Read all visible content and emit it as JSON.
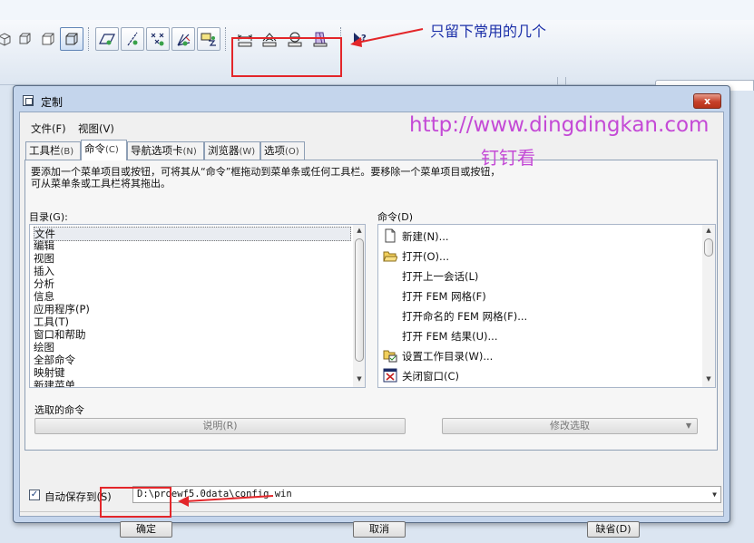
{
  "annotation": {
    "top_note": "只留下常用的几个",
    "watermark_url": "http://www.dingdingkan.com",
    "watermark_name": "钉钉看",
    "highlight_color": "#e3262a"
  },
  "toolbar": {
    "icons": [
      "view-cube-icon",
      "view-cube-outline-icon",
      "view-cube-front-icon",
      "shaded-cube-icon",
      "datum-plane-icon",
      "datum-axis-icon",
      "datum-point-icon",
      "coordinate-system-icon",
      "annotation-plane-icon",
      "measure-distance-icon",
      "measure-angle-icon",
      "measure-diameter-icon",
      "mass-properties-icon",
      "whats-this-help-icon"
    ]
  },
  "dialog": {
    "title": "定制",
    "close_label": "x",
    "menus": [
      "文件(F)",
      "视图(V)"
    ],
    "tabs": [
      {
        "label": "工具栏",
        "key": "(B)"
      },
      {
        "label": "命令",
        "key": "(C)"
      },
      {
        "label": "导航选项卡",
        "key": "(N)"
      },
      {
        "label": "浏览器",
        "key": "(W)"
      },
      {
        "label": "选项",
        "key": "(O)"
      }
    ],
    "description_line1": "要添加一个菜单项目或按钮，可将其从“命令”框拖动到菜单条或任何工具栏。要移除一个菜单项目或按钮，",
    "description_line2": "可从菜单条或工具栏将其拖出。",
    "categories_label": "目录(G):",
    "categories": [
      "文件",
      "编辑",
      "视图",
      "插入",
      "分析",
      "信息",
      "应用程序(P)",
      "工具(T)",
      "窗口和帮助",
      "绘图",
      "全部命令",
      "映射键",
      "新建菜单"
    ],
    "commands_label": "命令(D)",
    "commands": [
      {
        "label": "新建(N)...",
        "icon": "new-file-icon"
      },
      {
        "label": "打开(O)...",
        "icon": "open-folder-icon"
      },
      {
        "label": "打开上一会话(L)",
        "icon": ""
      },
      {
        "label": "打开 FEM 网格(F)",
        "icon": ""
      },
      {
        "label": "打开命名的 FEM 网格(F)...",
        "icon": ""
      },
      {
        "label": "打开 FEM 结果(U)...",
        "icon": ""
      },
      {
        "label": "设置工作目录(W)...",
        "icon": "working-directory-icon"
      },
      {
        "label": "关闭窗口(C)",
        "icon": "close-window-icon"
      }
    ],
    "selected_command_label": "选取的命令",
    "explain_button": "说明(R)",
    "modify_selection_button": "修改选取",
    "autosave_label": "自动保存到(S)",
    "autosave_checked": "✓",
    "autosave_path": "D:\\proewf5.0data\\config.win",
    "ok_button": "确定",
    "cancel_button": "取消",
    "default_button": "缺省(D)"
  }
}
